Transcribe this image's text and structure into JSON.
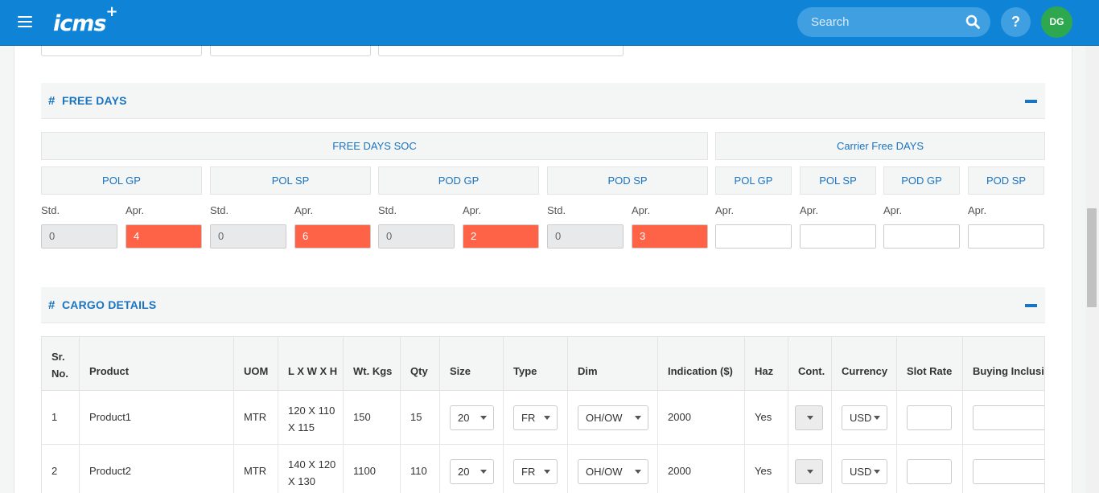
{
  "header": {
    "logo": "icms",
    "logo_plus": "+",
    "search_placeholder": "Search",
    "help": "?",
    "avatar": "DG",
    "colors": {
      "bar": "#0f84d6",
      "avatar": "#2ea84e"
    }
  },
  "free_days": {
    "hash": "#",
    "title": "FREE DAYS",
    "soc_label": "FREE DAYS SOC",
    "carrier_label": "Carrier Free DAYS",
    "soc_columns": [
      {
        "label": "POL GP",
        "std_label": "Std.",
        "apr_label": "Apr.",
        "std": "0",
        "apr": "4"
      },
      {
        "label": "POL SP",
        "std_label": "Std.",
        "apr_label": "Apr.",
        "std": "0",
        "apr": "6"
      },
      {
        "label": "POD GP",
        "std_label": "Std.",
        "apr_label": "Apr.",
        "std": "0",
        "apr": "2"
      },
      {
        "label": "POD SP",
        "std_label": "Std.",
        "apr_label": "Apr.",
        "std": "0",
        "apr": "3"
      }
    ],
    "carrier_columns": [
      {
        "label": "POL GP",
        "apr_label": "Apr.",
        "apr": ""
      },
      {
        "label": "POL SP",
        "apr_label": "Apr.",
        "apr": ""
      },
      {
        "label": "POD GP",
        "apr_label": "Apr.",
        "apr": ""
      },
      {
        "label": "POD SP",
        "apr_label": "Apr.",
        "apr": ""
      }
    ],
    "highlight_color": "#ff6347"
  },
  "cargo": {
    "hash": "#",
    "title": "CARGO DETAILS",
    "headers": [
      "Sr.\nNo.",
      "Product",
      "UOM",
      "L X W X H",
      "Wt. Kgs",
      "Qty",
      "Size",
      "Type",
      "Dim",
      "Indication ($)",
      "Haz",
      "Cont.",
      "Currency",
      "Slot Rate",
      "Buying Inclusive"
    ],
    "rows": [
      {
        "sr": "1",
        "product": "Product1",
        "uom": "MTR",
        "lwh1": "120 X 110",
        "lwh2": "X 115",
        "wt": "150",
        "qty": "15",
        "size": "20",
        "type": "FR",
        "dim": "OH/OW",
        "indication": "2000",
        "haz": "Yes",
        "cont": "",
        "currency": "USD",
        "slot_rate": "",
        "buying": ""
      },
      {
        "sr": "2",
        "product": "Product2",
        "uom": "MTR",
        "lwh1": "140 X 120",
        "lwh2": "X 130",
        "wt": "1100",
        "qty": "110",
        "size": "20",
        "type": "FR",
        "dim": "OH/OW",
        "indication": "2000",
        "haz": "Yes",
        "cont": "",
        "currency": "USD",
        "slot_rate": "",
        "buying": ""
      }
    ]
  }
}
